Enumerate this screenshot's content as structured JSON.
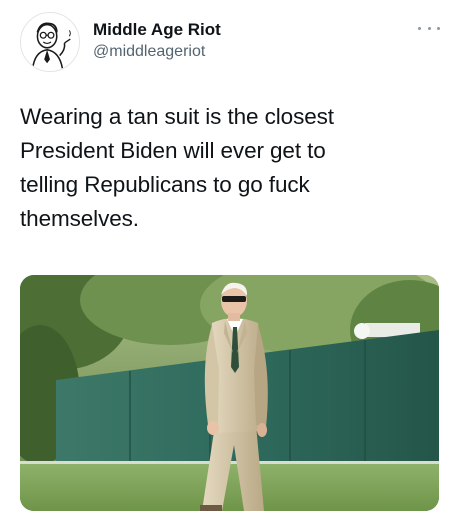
{
  "author": {
    "display_name": "Middle Age Riot",
    "handle": "@middleageriot",
    "avatar_icon": "cartoon-man-avatar"
  },
  "menu": {
    "icon": "more-horizontal-icon"
  },
  "tweet": {
    "lines": [
      "Wearing a tan suit is the closest",
      "President Biden will ever get to",
      "telling Republicans to go fuck",
      "themselves."
    ]
  },
  "media": {
    "type": "photo"
  },
  "colors": {
    "text": "#0f1419",
    "secondary": "#536471",
    "grass": "#7ea35a",
    "fence": "#2f6b5e",
    "suit": "#cdbf9f"
  }
}
